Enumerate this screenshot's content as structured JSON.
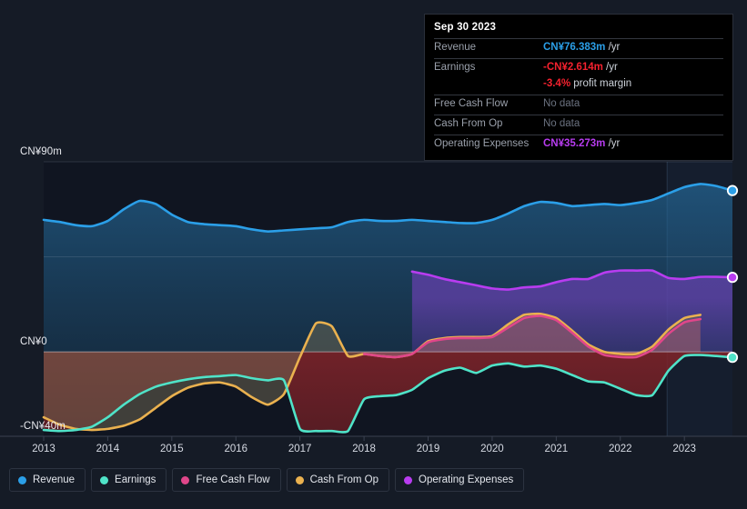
{
  "tooltip": {
    "date": "Sep 30 2023",
    "rows": [
      {
        "label": "Revenue",
        "value": "CN¥76.383m",
        "unit": " /yr",
        "color": "#2b9fe8",
        "nodata": false
      },
      {
        "label": "Earnings",
        "value": "-CN¥2.614m",
        "unit": " /yr",
        "color": "#f4212e",
        "nodata": false
      },
      {
        "label": "",
        "value": "-3.4%",
        "unit": " profit margin",
        "color": "#f4212e",
        "nodata": false,
        "continuation": true
      },
      {
        "label": "Free Cash Flow",
        "value": "No data",
        "unit": "",
        "color": "#6b7280",
        "nodata": true
      },
      {
        "label": "Cash From Op",
        "value": "No data",
        "unit": "",
        "color": "#6b7280",
        "nodata": true
      },
      {
        "label": "Operating Expenses",
        "value": "CN¥35.273m",
        "unit": " /yr",
        "color": "#b83cf0",
        "nodata": false
      }
    ]
  },
  "legend": [
    {
      "label": "Revenue",
      "color": "#2b9fe8"
    },
    {
      "label": "Earnings",
      "color": "#4fe3c8"
    },
    {
      "label": "Free Cash Flow",
      "color": "#e0468a"
    },
    {
      "label": "Cash From Op",
      "color": "#eab14f"
    },
    {
      "label": "Operating Expenses",
      "color": "#b83cf0"
    }
  ],
  "chart_data": {
    "type": "area",
    "title": "",
    "xlabel": "",
    "ylabel": "",
    "currency": "CN¥",
    "grid": true,
    "legend_position": "bottom",
    "ylim": [
      -40,
      90
    ],
    "y_ticks": [
      {
        "value": 90,
        "label": "CN¥90m"
      },
      {
        "value": 45,
        "label": ""
      },
      {
        "value": 0,
        "label": "CN¥0"
      },
      {
        "value": -40,
        "label": "-CN¥40m"
      }
    ],
    "x_ticks": [
      "2013",
      "2014",
      "2015",
      "2016",
      "2017",
      "2018",
      "2019",
      "2020",
      "2021",
      "2022",
      "2023"
    ],
    "xlim": [
      2013,
      2023.75
    ],
    "highlight_band": {
      "from": 2022.73,
      "to": 2023.75
    },
    "series": [
      {
        "name": "Revenue",
        "color": "#2b9fe8",
        "fill": "rgba(36,110,160,0.55)",
        "x": [
          2013,
          2013.25,
          2013.5,
          2013.75,
          2014,
          2014.25,
          2014.5,
          2014.75,
          2015,
          2015.25,
          2015.5,
          2015.75,
          2016,
          2016.25,
          2016.5,
          2016.75,
          2017,
          2017.25,
          2017.5,
          2017.75,
          2018,
          2018.25,
          2018.5,
          2018.75,
          2019,
          2019.25,
          2019.5,
          2019.75,
          2020,
          2020.25,
          2020.5,
          2020.75,
          2021,
          2021.25,
          2021.5,
          2021.75,
          2022,
          2022.25,
          2022.5,
          2022.75,
          2023,
          2023.25,
          2023.5,
          2023.75
        ],
        "values": [
          62.5,
          61.5,
          60.0,
          59.5,
          62.0,
          67.5,
          71.5,
          70.0,
          65.0,
          61.5,
          60.5,
          60.0,
          59.5,
          58.0,
          57.0,
          57.5,
          58.0,
          58.5,
          59.0,
          61.5,
          62.5,
          62.0,
          62.0,
          62.5,
          62.0,
          61.5,
          61.0,
          61.0,
          62.5,
          65.5,
          69.0,
          71.0,
          70.5,
          69.0,
          69.5,
          70.0,
          69.5,
          70.5,
          72.0,
          75.0,
          78.0,
          79.5,
          78.5,
          76.383
        ]
      },
      {
        "name": "Earnings",
        "color": "#4fe3c8",
        "fill": "rgba(120,35,40,0.78)",
        "x": [
          2013,
          2013.25,
          2013.5,
          2013.75,
          2014,
          2014.25,
          2014.5,
          2014.75,
          2015,
          2015.25,
          2015.5,
          2015.75,
          2016,
          2016.25,
          2016.5,
          2016.75,
          2017,
          2017.25,
          2017.5,
          2017.75,
          2018,
          2018.25,
          2018.5,
          2018.75,
          2019,
          2019.25,
          2019.5,
          2019.75,
          2020,
          2020.25,
          2020.5,
          2020.75,
          2021,
          2021.25,
          2021.5,
          2021.75,
          2022,
          2022.25,
          2022.5,
          2022.75,
          2023,
          2023.25,
          2023.5,
          2023.75
        ],
        "values": [
          -37.0,
          -37.5,
          -37.0,
          -35.5,
          -31.0,
          -25.0,
          -20.0,
          -16.5,
          -14.5,
          -13.0,
          -12.0,
          -11.5,
          -11.0,
          -12.5,
          -13.5,
          -13.5,
          -36.5,
          -37.5,
          -37.5,
          -37.5,
          -22.5,
          -21.0,
          -20.5,
          -18.0,
          -12.5,
          -9.0,
          -7.5,
          -10.0,
          -6.5,
          -5.5,
          -7.0,
          -6.5,
          -8.0,
          -11.0,
          -14.0,
          -14.5,
          -17.5,
          -20.5,
          -20.5,
          -9.0,
          -2.0,
          -1.5,
          -2.0,
          -2.614
        ]
      },
      {
        "name": "Free Cash Flow",
        "color": "#e0468a",
        "fill": "rgba(170,70,120,0.42)",
        "x": [
          2018,
          2018.25,
          2018.5,
          2018.75,
          2019,
          2019.25,
          2019.5,
          2019.75,
          2020,
          2020.25,
          2020.5,
          2020.75,
          2021,
          2021.25,
          2021.5,
          2021.75,
          2022,
          2022.25,
          2022.5,
          2022.75,
          2023,
          2023.25
        ],
        "values": [
          -1.0,
          -2.0,
          -2.5,
          -1.0,
          4.5,
          6.0,
          6.5,
          6.5,
          7.0,
          11.5,
          16.0,
          17.0,
          15.0,
          9.0,
          2.5,
          -1.5,
          -2.5,
          -2.5,
          1.0,
          8.5,
          14.0,
          15.5
        ],
        "ends_early": true,
        "note": "No data for latest period"
      },
      {
        "name": "Cash From Op",
        "color": "#eab14f",
        "fill": "rgba(110,105,80,0.45)",
        "x": [
          2013,
          2013.25,
          2013.5,
          2013.75,
          2014,
          2014.25,
          2014.5,
          2014.75,
          2015,
          2015.25,
          2015.5,
          2015.75,
          2016,
          2016.25,
          2016.5,
          2016.75,
          2017,
          2017.25,
          2017.5,
          2017.75,
          2018,
          2018.25,
          2018.5,
          2018.75,
          2019,
          2019.25,
          2019.5,
          2019.75,
          2020,
          2020.25,
          2020.5,
          2020.75,
          2021,
          2021.25,
          2021.5,
          2021.75,
          2022,
          2022.25,
          2022.5,
          2022.75,
          2023,
          2023.25
        ],
        "values": [
          -31.0,
          -34.5,
          -36.5,
          -37.0,
          -36.5,
          -35.0,
          -32.0,
          -26.5,
          -21.0,
          -17.0,
          -15.0,
          -14.5,
          -16.5,
          -21.5,
          -25.0,
          -20.0,
          -2.5,
          13.5,
          12.0,
          -2.0,
          -1.0,
          -2.0,
          -2.5,
          -1.0,
          5.0,
          6.5,
          7.0,
          7.0,
          7.5,
          13.0,
          17.5,
          18.0,
          16.0,
          10.0,
          3.5,
          0.0,
          -1.0,
          -1.0,
          2.5,
          10.5,
          16.0,
          17.5
        ],
        "ends_early": true,
        "note": "No data for latest period"
      },
      {
        "name": "Operating Expenses",
        "color": "#b83cf0",
        "fill": "rgba(96,62,168,0.62)",
        "x": [
          2018.75,
          2019,
          2019.25,
          2019.5,
          2019.75,
          2020,
          2020.25,
          2020.5,
          2020.75,
          2021,
          2021.25,
          2021.5,
          2021.75,
          2022,
          2022.25,
          2022.5,
          2022.75,
          2023,
          2023.25,
          2023.5,
          2023.75
        ],
        "values": [
          38.0,
          36.5,
          34.5,
          33.0,
          31.5,
          30.0,
          29.5,
          30.5,
          31.0,
          33.0,
          34.5,
          34.5,
          37.5,
          38.5,
          38.5,
          38.5,
          35.0,
          34.5,
          35.5,
          35.5,
          35.273
        ]
      }
    ]
  }
}
